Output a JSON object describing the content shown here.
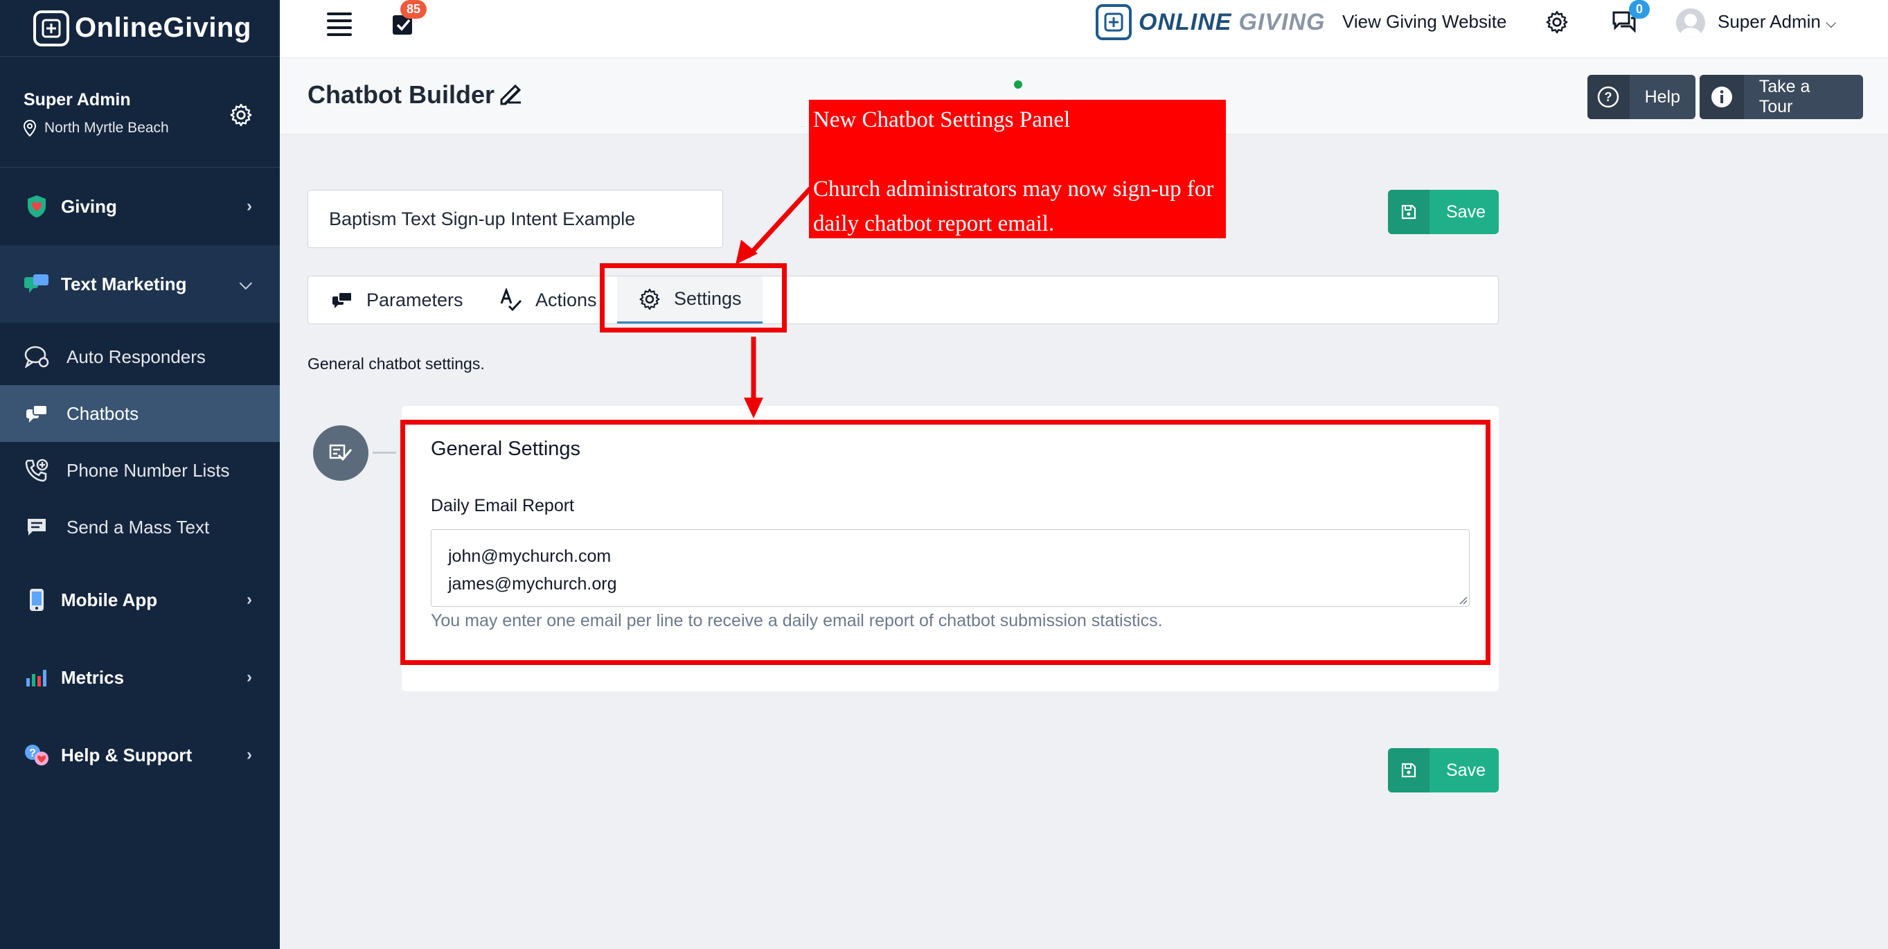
{
  "sidebar": {
    "brand": "OnlineGiving",
    "user_name": "Super Admin",
    "user_location": "North Myrtle Beach",
    "nav": {
      "giving": "Giving",
      "text_marketing": "Text Marketing",
      "mobile_app": "Mobile App",
      "metrics": "Metrics",
      "help_support": "Help & Support"
    },
    "sub_items": [
      "Auto Responders",
      "Chatbots",
      "Phone Number Lists",
      "Send a Mass Text"
    ],
    "active_sub_item": "Chatbots"
  },
  "topbar": {
    "tasks_count": "85",
    "logo_text_1": "ONLINE",
    "logo_text_2": "GIVING",
    "view_website": "View Giving Website",
    "messages_count": "0",
    "user_menu": "Super Admin"
  },
  "header": {
    "title": "Chatbot Builder",
    "help_label": "Help",
    "tour_label": "Take a Tour"
  },
  "content": {
    "chatbot_name": "Baptism Text Sign-up Intent Example",
    "save_label": "Save",
    "tabs": [
      "Parameters",
      "Actions",
      "Settings"
    ],
    "active_tab": "Settings",
    "description": "General chatbot settings.",
    "card_title": "General Settings",
    "field_label": "Daily Email Report",
    "emails": [
      "john@mychurch.com",
      "james@mychurch.org"
    ],
    "help_text": "You may enter one email per line to receive a daily email report of chatbot submission statistics."
  },
  "annotation": {
    "line1": "New Chatbot Settings Panel",
    "line2": "Church administrators may now sign-up for daily chatbot report email."
  },
  "colors": {
    "sidebar_bg": "#14263e",
    "accent_green": "#1fb089",
    "annotation_red": "#ff0000",
    "badge_orange": "#ef5a3c",
    "badge_blue": "#2d9be6"
  }
}
